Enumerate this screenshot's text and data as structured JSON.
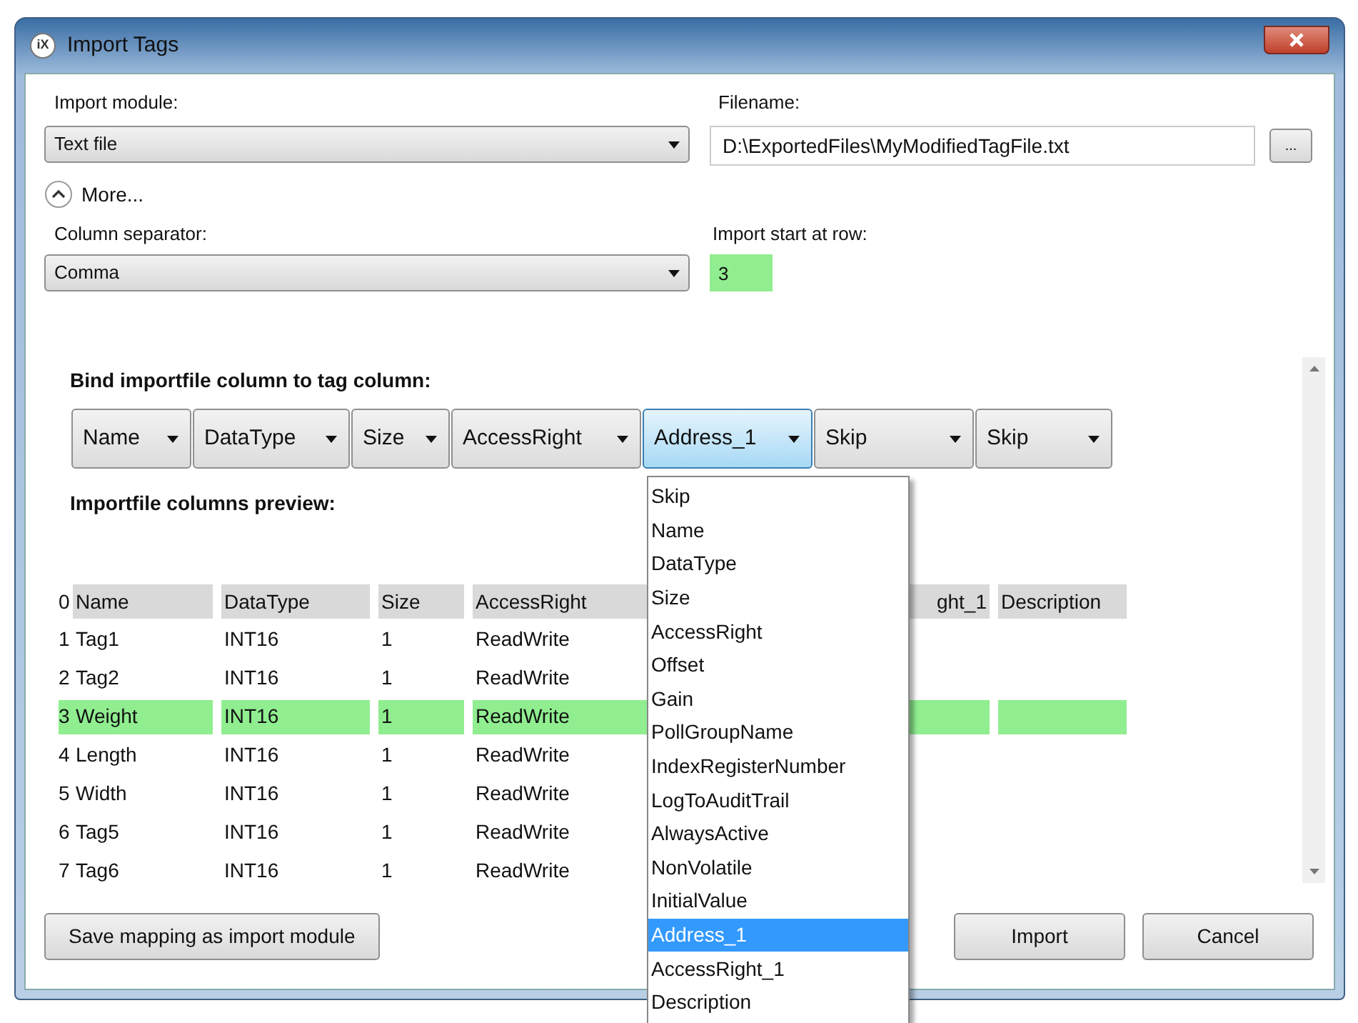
{
  "window": {
    "title": "Import Tags",
    "app_icon": "iX"
  },
  "import_module": {
    "label": "Import module:",
    "value": "Text file"
  },
  "filename": {
    "label": "Filename:",
    "value": "D:\\ExportedFiles\\MyModifiedTagFile.txt",
    "browse": "..."
  },
  "more": {
    "label": "More...",
    "expanded": true
  },
  "column_separator": {
    "label": "Column separator:",
    "value": "Comma"
  },
  "start_row": {
    "label": "Import start at row:",
    "value": "3"
  },
  "bind": {
    "label": "Bind importfile column to tag column:",
    "columns": [
      {
        "value": "Name",
        "selected": false
      },
      {
        "value": "DataType",
        "selected": false
      },
      {
        "value": "Size",
        "selected": false
      },
      {
        "value": "AccessRight",
        "selected": false
      },
      {
        "value": "Address_1",
        "selected": true
      },
      {
        "value": "Skip",
        "selected": false
      },
      {
        "value": "Skip",
        "selected": false
      }
    ]
  },
  "preview": {
    "label": "Importfile columns preview:",
    "header_index": "0",
    "columns": [
      "Name",
      "DataType",
      "Size",
      "AccessRight",
      "",
      "ght_1",
      "Description"
    ],
    "rows": [
      {
        "index": "1",
        "cells": [
          "Tag1",
          "INT16",
          "1",
          "ReadWrite"
        ],
        "selected": false
      },
      {
        "index": "2",
        "cells": [
          "Tag2",
          "INT16",
          "1",
          "ReadWrite"
        ],
        "selected": false
      },
      {
        "index": "3",
        "cells": [
          "Weight",
          "INT16",
          "1",
          "ReadWrite"
        ],
        "selected": true
      },
      {
        "index": "4",
        "cells": [
          "Length",
          "INT16",
          "1",
          "ReadWrite"
        ],
        "selected": false
      },
      {
        "index": "5",
        "cells": [
          "Width",
          "INT16",
          "1",
          "ReadWrite"
        ],
        "selected": false
      },
      {
        "index": "6",
        "cells": [
          "Tag5",
          "INT16",
          "1",
          "ReadWrite"
        ],
        "selected": false
      },
      {
        "index": "7",
        "cells": [
          "Tag6",
          "INT16",
          "1",
          "ReadWrite"
        ],
        "selected": false
      }
    ]
  },
  "dropdown": {
    "items": [
      {
        "label": "Skip",
        "selected": false
      },
      {
        "label": "Name",
        "selected": false
      },
      {
        "label": "DataType",
        "selected": false
      },
      {
        "label": "Size",
        "selected": false
      },
      {
        "label": "AccessRight",
        "selected": false
      },
      {
        "label": "Offset",
        "selected": false
      },
      {
        "label": "Gain",
        "selected": false
      },
      {
        "label": "PollGroupName",
        "selected": false
      },
      {
        "label": "IndexRegisterNumber",
        "selected": false
      },
      {
        "label": "LogToAuditTrail",
        "selected": false
      },
      {
        "label": "AlwaysActive",
        "selected": false
      },
      {
        "label": "NonVolatile",
        "selected": false
      },
      {
        "label": "InitialValue",
        "selected": false
      },
      {
        "label": "Address_1",
        "selected": true
      },
      {
        "label": "AccessRight_1",
        "selected": false
      },
      {
        "label": "Description",
        "selected": false
      }
    ]
  },
  "buttons": {
    "save": "Save mapping as import module",
    "import": "Import",
    "cancel": "Cancel"
  }
}
